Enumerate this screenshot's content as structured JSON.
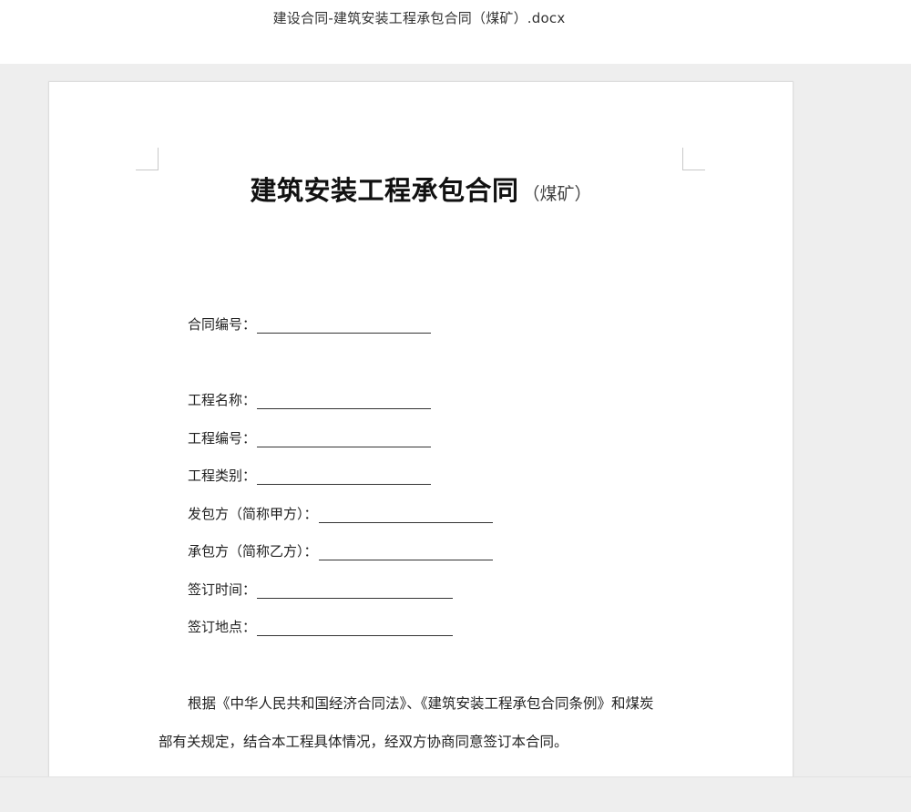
{
  "window": {
    "file_title": "建设合同-建筑安装工程承包合同（煤矿）.docx"
  },
  "document": {
    "title_main": "建筑安装工程承包合同",
    "title_sub": "（煤矿）",
    "fields": [
      {
        "label": "合同编号："
      },
      {
        "label": "工程名称："
      },
      {
        "label": "工程编号："
      },
      {
        "label": "工程类别："
      },
      {
        "label": "发包方（简称甲方）："
      },
      {
        "label": "承包方（简称乙方）："
      },
      {
        "label": "签订时间："
      },
      {
        "label": "签订地点："
      }
    ],
    "paragraph_line1": "根据《中华人民共和国经济合同法》、《建筑安装工程承包合同条例》和煤炭",
    "paragraph_line2": "部有关规定，结合本工程具体情况，经双方协商同意签订本合同。"
  }
}
